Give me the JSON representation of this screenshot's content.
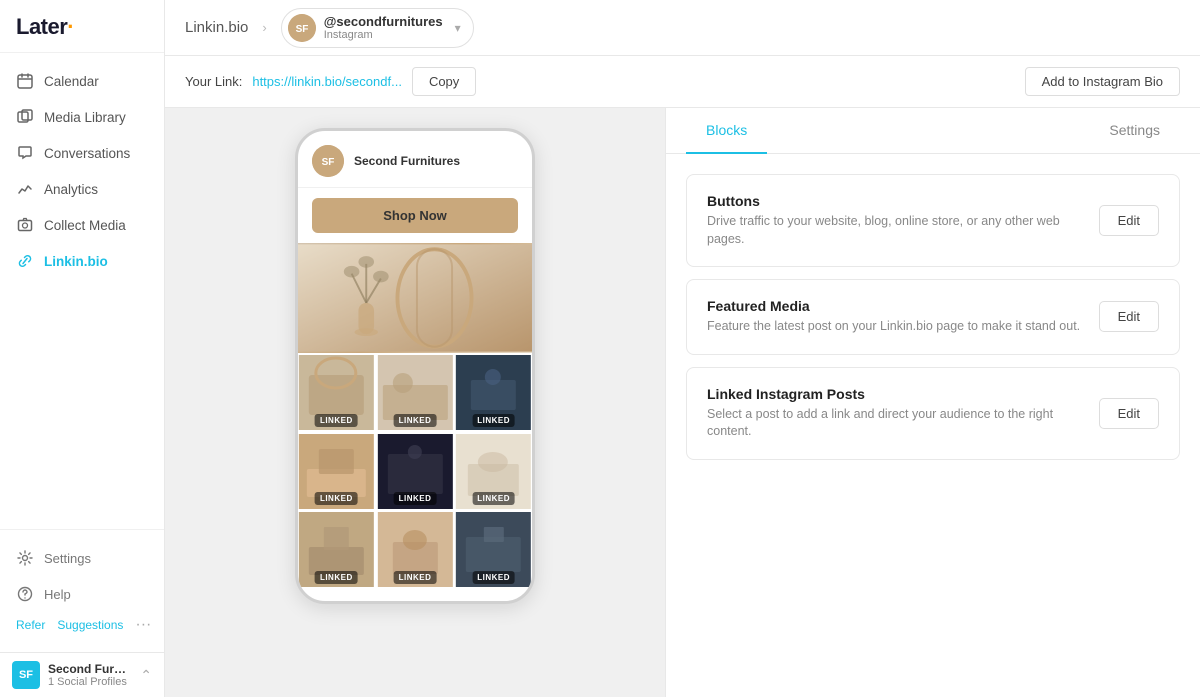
{
  "app": {
    "logo": "Later",
    "logo_dot": "·"
  },
  "sidebar": {
    "nav_items": [
      {
        "id": "calendar",
        "label": "Calendar",
        "icon": "📅"
      },
      {
        "id": "media-library",
        "label": "Media Library",
        "icon": "🖼"
      },
      {
        "id": "conversations",
        "label": "Conversations",
        "icon": "💬"
      },
      {
        "id": "analytics",
        "label": "Analytics",
        "icon": "📈"
      },
      {
        "id": "collect-media",
        "label": "Collect Media",
        "icon": "📷"
      },
      {
        "id": "linkin-bio",
        "label": "Linkin.bio",
        "icon": "🔗",
        "active": true
      }
    ],
    "bottom_items": [
      {
        "id": "settings",
        "label": "Settings",
        "icon": "⚙️"
      },
      {
        "id": "help",
        "label": "Help",
        "icon": "❓"
      }
    ],
    "footer": {
      "refer": "Refer",
      "suggestions": "Suggestions"
    },
    "account": {
      "initials": "SF",
      "name": "Second Furnitur...",
      "sub": "1 Social Profiles"
    }
  },
  "topbar": {
    "breadcrumb": "Linkin.bio",
    "profile_handle": "@secondfurnitures",
    "profile_platform": "Instagram"
  },
  "linkbar": {
    "link_label": "Your Link:",
    "link_url": "https://linkin.bio/secondf...",
    "copy_label": "Copy",
    "add_bio_label": "Add to Instagram Bio"
  },
  "preview": {
    "username": "Second Furnitures",
    "shop_btn": "Shop Now",
    "grid": [
      {
        "id": "c1",
        "color": "gc1",
        "linked": true
      },
      {
        "id": "c2",
        "color": "gc2",
        "linked": true
      },
      {
        "id": "c3",
        "color": "gc3",
        "linked": true
      },
      {
        "id": "c4",
        "color": "gc4",
        "linked": true
      },
      {
        "id": "c5",
        "color": "gc5",
        "linked": true
      },
      {
        "id": "c6",
        "color": "gc6",
        "linked": true
      },
      {
        "id": "c7",
        "color": "gc7",
        "linked": true
      },
      {
        "id": "c8",
        "color": "gc8",
        "linked": true
      },
      {
        "id": "c9",
        "color": "gc9",
        "linked": true
      }
    ],
    "linked_label": "LINKED"
  },
  "right_panel": {
    "tabs": [
      {
        "id": "blocks",
        "label": "Blocks",
        "active": true
      },
      {
        "id": "settings",
        "label": "Settings",
        "active": false
      }
    ],
    "blocks": [
      {
        "id": "buttons",
        "title": "Buttons",
        "description": "Drive traffic to your website, blog, online store, or any other web pages.",
        "edit_label": "Edit"
      },
      {
        "id": "featured-media",
        "title": "Featured Media",
        "description": "Feature the latest post on your Linkin.bio page to make it stand out.",
        "edit_label": "Edit"
      },
      {
        "id": "linked-instagram-posts",
        "title": "Linked Instagram Posts",
        "description": "Select a post to add a link and direct your audience to the right content.",
        "edit_label": "Edit"
      }
    ]
  }
}
